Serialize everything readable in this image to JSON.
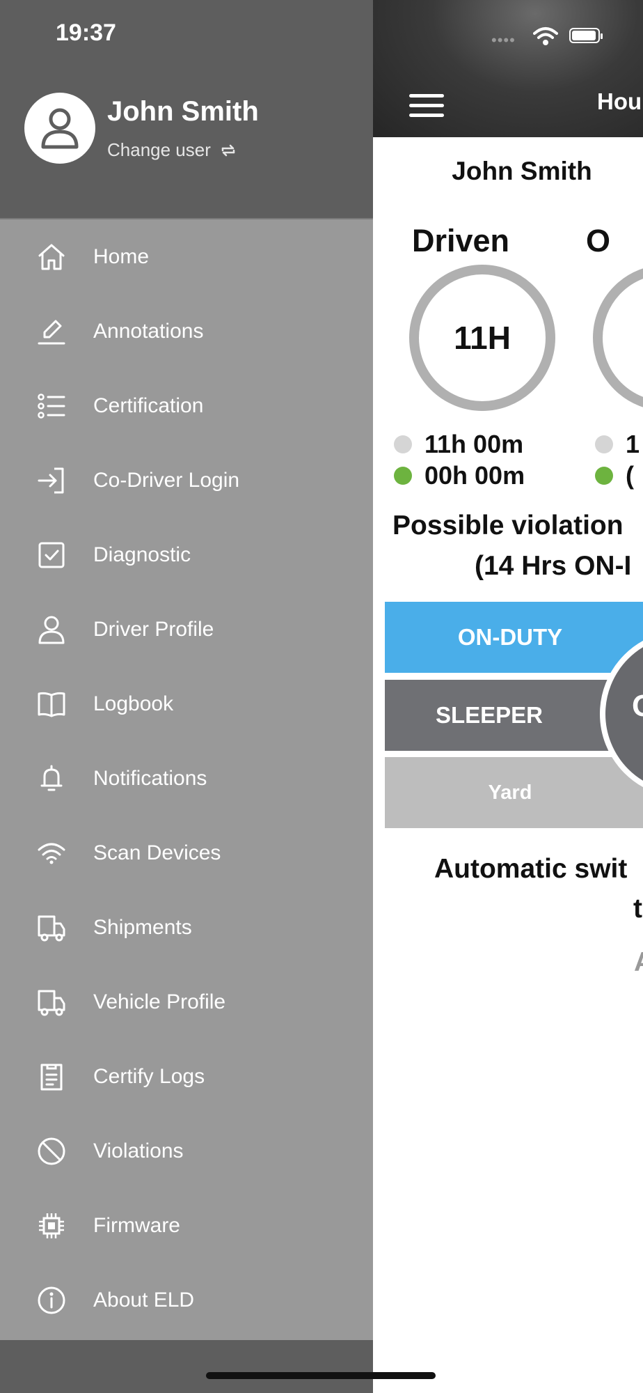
{
  "status_bar": {
    "time": "19:37"
  },
  "drawer": {
    "user_name": "John Smith",
    "change_user_label": "Change user",
    "menu": [
      {
        "label": "Home",
        "icon": "home-icon"
      },
      {
        "label": "Annotations",
        "icon": "pencil-icon"
      },
      {
        "label": "Certification",
        "icon": "list-icon"
      },
      {
        "label": "Co-Driver Login",
        "icon": "login-icon"
      },
      {
        "label": "Diagnostic",
        "icon": "checkbox-icon"
      },
      {
        "label": "Driver Profile",
        "icon": "user-icon"
      },
      {
        "label": "Logbook",
        "icon": "book-icon"
      },
      {
        "label": "Notifications",
        "icon": "bell-icon"
      },
      {
        "label": "Scan Devices",
        "icon": "wifi-icon"
      },
      {
        "label": "Shipments",
        "icon": "truck-icon"
      },
      {
        "label": "Vehicle Profile",
        "icon": "truck-icon"
      },
      {
        "label": "Certify Logs",
        "icon": "clipboard-icon"
      },
      {
        "label": "Violations",
        "icon": "prohibited-icon"
      },
      {
        "label": "Firmware",
        "icon": "chip-icon"
      },
      {
        "label": "About ELD",
        "icon": "info-icon"
      }
    ]
  },
  "app": {
    "header_title": "Hou",
    "driver_name": "John Smith",
    "driven": {
      "title": "Driven",
      "ring_value": "11H",
      "remaining": "11h 00m",
      "used": "00h 00m"
    },
    "second": {
      "title": "O",
      "remaining": "1",
      "used": "("
    },
    "violation_line1": "Possible violation",
    "violation_line2": "(14 Hrs ON-I",
    "buttons": {
      "on_duty": "ON-DUTY",
      "sleeper": "SLEEPER",
      "yard": "Yard",
      "circle": "O"
    },
    "auto_line1": "Automatic swit",
    "auto_line2": "t",
    "auto_line3": "A"
  },
  "colors": {
    "drawer_bg": "#999999",
    "drawer_header_bg": "#5e5e5e",
    "on_duty": "#4aaee9",
    "sleeper": "#6f7074",
    "yard": "#bdbdbd",
    "ring": "#b0b0b0",
    "dot_remaining": "#d5d5d5",
    "dot_used": "#6db33f"
  }
}
